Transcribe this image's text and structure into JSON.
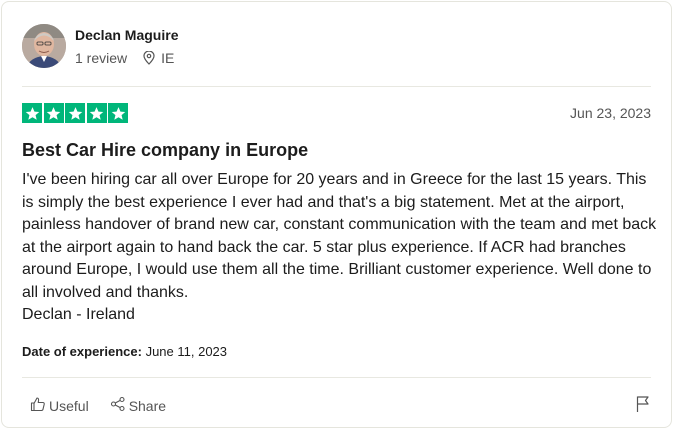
{
  "reviewer": {
    "name": "Declan Maguire",
    "review_count": "1 review",
    "country": "IE",
    "avatar_icon": "user-photo"
  },
  "review": {
    "rating": 5,
    "rating_max": 5,
    "date": "Jun 23, 2023",
    "title": "Best Car Hire company in Europe",
    "body": "I've been hiring car all over Europe for 20 years and in Greece for the last 15 years. This is simply the best experience I ever had and that's a big statement. Met at the airport, painless handover of brand new car, constant communication with the team and met back at the airport again to hand back the car. 5 star plus experience. If ACR had branches around Europe, I would use them all the time. Brilliant customer experience. Well done to all involved and thanks.\nDeclan - Ireland",
    "experience_label": "Date of experience:",
    "experience_date": "June 11, 2023"
  },
  "actions": {
    "useful_label": "Useful",
    "share_label": "Share"
  },
  "colors": {
    "star_green": "#00b67a",
    "divider": "#e8e8e1",
    "muted_text": "#555555"
  }
}
